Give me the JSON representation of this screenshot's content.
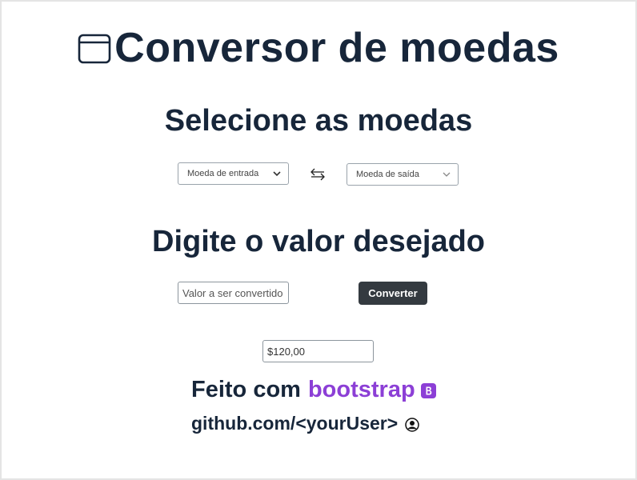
{
  "header": {
    "title": "Conversor de moedas",
    "icon": "window-icon"
  },
  "select_section": {
    "heading": "Selecione as moedas",
    "input_currency": {
      "selected": "Moeda de entrada"
    },
    "output_currency": {
      "selected": "Moeda de saída"
    },
    "swap_icon": "swap-arrows-icon"
  },
  "value_section": {
    "heading": "Digite o valor desejado",
    "amount_input": {
      "placeholder": "Valor a ser convertido",
      "value": ""
    },
    "convert_label": "Converter"
  },
  "result": {
    "value": "$120,00"
  },
  "footer": {
    "made_with": "Feito com",
    "brand": "bootstrap",
    "brand_icon": "bootstrap-icon",
    "github": "github.com/<yourUser>",
    "github_icon": "person-circle-icon"
  },
  "colors": {
    "text": "#17263a",
    "brand": "#8c3fd6",
    "button_bg": "#343a40",
    "button_text": "#ffffff"
  }
}
